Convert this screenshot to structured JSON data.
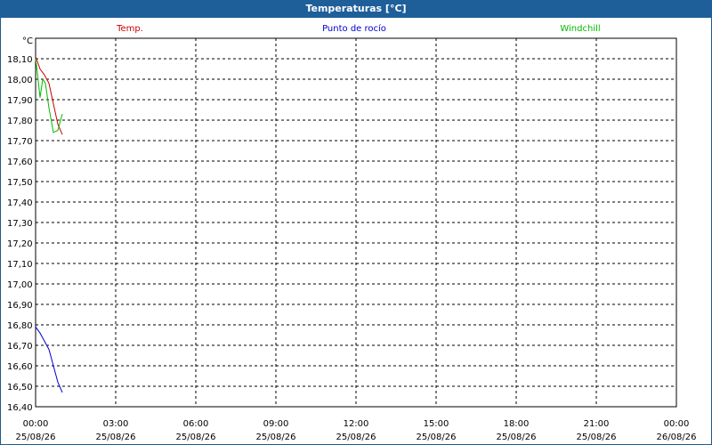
{
  "window": {
    "title": "Temperaturas [°C]"
  },
  "chart_data": {
    "type": "line",
    "title": "Temperaturas [°C]",
    "ylabel": "°C",
    "xlabel": "",
    "ylim": [
      16.4,
      18.2
    ],
    "xlim": [
      "2026-08-25 00:00",
      "2026-08-26 00:00"
    ],
    "grid": true,
    "legend_placement": "top",
    "y_ticks": [
      "16,40",
      "16,50",
      "16,60",
      "16,70",
      "16,80",
      "16,90",
      "17,00",
      "17,10",
      "17,20",
      "17,30",
      "17,40",
      "17,50",
      "17,60",
      "17,70",
      "17,80",
      "17,90",
      "18,00",
      "18,10"
    ],
    "x_ticks": [
      {
        "time": "00:00",
        "date": "25/08/26"
      },
      {
        "time": "03:00",
        "date": "25/08/26"
      },
      {
        "time": "06:00",
        "date": "25/08/26"
      },
      {
        "time": "09:00",
        "date": "25/08/26"
      },
      {
        "time": "12:00",
        "date": "25/08/26"
      },
      {
        "time": "15:00",
        "date": "25/08/26"
      },
      {
        "time": "18:00",
        "date": "25/08/26"
      },
      {
        "time": "21:00",
        "date": "25/08/26"
      },
      {
        "time": "00:00",
        "date": "26/08/26"
      }
    ],
    "series": [
      {
        "name": "Temp.",
        "color": "#cc0000",
        "x": [
          "2026-08-25 00:00",
          "2026-08-25 00:10",
          "2026-08-25 00:20",
          "2026-08-25 00:30",
          "2026-08-25 00:40",
          "2026-08-25 00:50",
          "2026-08-25 01:00"
        ],
        "values": [
          18.11,
          18.05,
          18.02,
          17.98,
          17.88,
          17.78,
          17.73
        ]
      },
      {
        "name": "Punto de rocío",
        "color": "#0000cc",
        "x": [
          "2026-08-25 00:00",
          "2026-08-25 00:10",
          "2026-08-25 00:20",
          "2026-08-25 00:30",
          "2026-08-25 00:40",
          "2026-08-25 00:50",
          "2026-08-25 01:00"
        ],
        "values": [
          16.79,
          16.76,
          16.72,
          16.68,
          16.6,
          16.52,
          16.47
        ]
      },
      {
        "name": "Windchill",
        "color": "#00bb00",
        "x": [
          "2026-08-25 00:00",
          "2026-08-25 00:04",
          "2026-08-25 00:10",
          "2026-08-25 00:16",
          "2026-08-25 00:22",
          "2026-08-25 00:30",
          "2026-08-25 00:40",
          "2026-08-25 00:50",
          "2026-08-25 01:00"
        ],
        "values": [
          18.1,
          18.03,
          17.91,
          18.0,
          17.98,
          17.86,
          17.74,
          17.75,
          17.83
        ]
      }
    ]
  }
}
